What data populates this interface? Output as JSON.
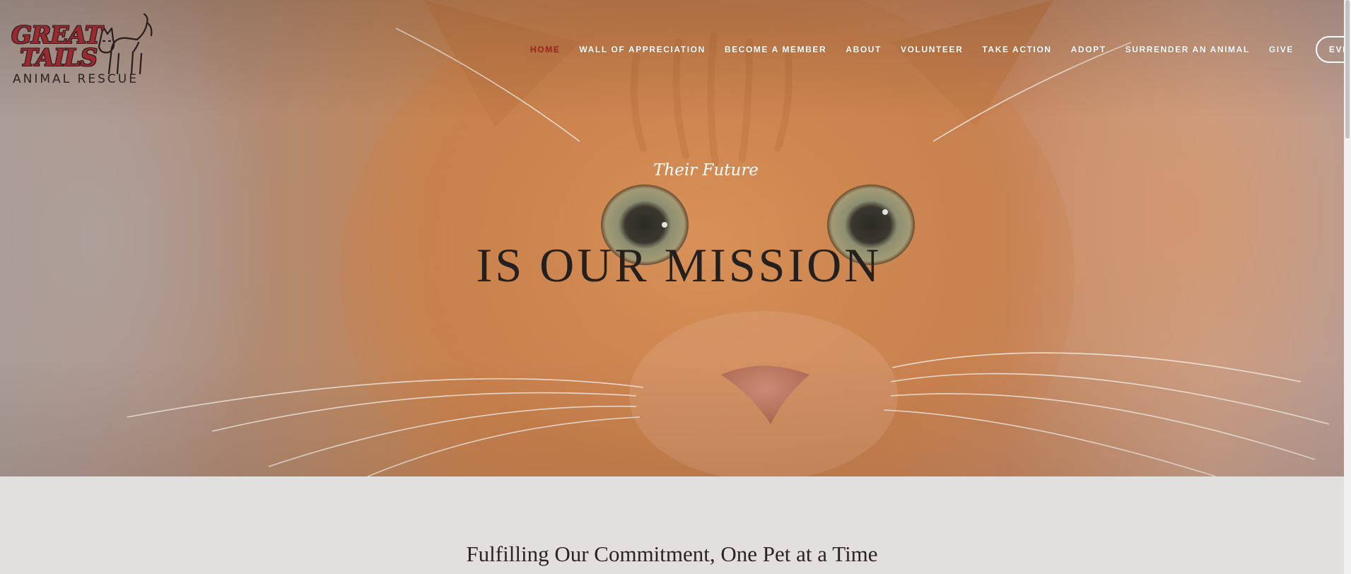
{
  "logo": {
    "line1": "GREAT",
    "line2": "TAILS",
    "tagline": "ANIMAL RESCUE"
  },
  "nav": {
    "items": [
      {
        "label": "HOME",
        "active": true
      },
      {
        "label": "WALL OF APPRECIATION",
        "active": false
      },
      {
        "label": "BECOME A MEMBER",
        "active": false
      },
      {
        "label": "ABOUT",
        "active": false
      },
      {
        "label": "VOLUNTEER",
        "active": false
      },
      {
        "label": "TAKE ACTION",
        "active": false
      },
      {
        "label": "ADOPT",
        "active": false
      },
      {
        "label": "SURRENDER AN ANIMAL",
        "active": false
      },
      {
        "label": "GIVE",
        "active": false
      }
    ],
    "events_label": "EVENTS"
  },
  "hero": {
    "subtitle": "Their Future",
    "title": "IS OUR MISSION"
  },
  "section": {
    "heading": "Fulfilling Our Commitment, One Pet at a Time"
  },
  "colors": {
    "accent": "#a4241f",
    "brand_red": "#9a2a2f",
    "lower_background": "#e2dfdf"
  }
}
